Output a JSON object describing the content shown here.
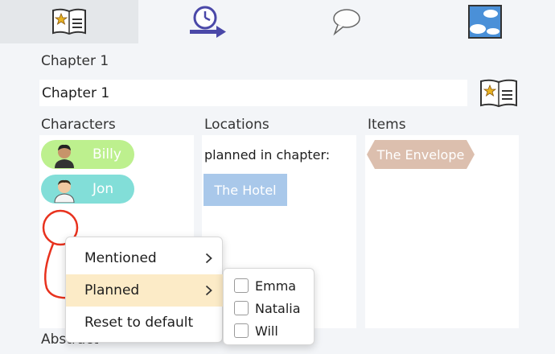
{
  "tabs": [
    {
      "name": "chapter-tab",
      "icon": "chapter-book-icon",
      "active": true
    },
    {
      "name": "timeline-tab",
      "icon": "clock-arrow-icon",
      "active": false
    },
    {
      "name": "dialogue-tab",
      "icon": "speech-bubble-icon",
      "active": false
    },
    {
      "name": "scene-tab",
      "icon": "sky-picture-icon",
      "active": false
    }
  ],
  "chapter": {
    "label": "Chapter 1",
    "title_value": "Chapter 1"
  },
  "columns": {
    "characters": "Characters",
    "locations": "Locations",
    "items": "Items"
  },
  "characters": [
    {
      "name": "Billy",
      "color": "#bdf08e"
    },
    {
      "name": "Jon",
      "color": "#82ded8"
    }
  ],
  "locations": {
    "section_label": "planned in chapter:",
    "entries": [
      {
        "name": "The Hotel",
        "color": "#a9c8ea"
      }
    ]
  },
  "items": [
    {
      "name": "The Envelope",
      "color": "#dcbfae"
    }
  ],
  "abstract_label": "Abstract",
  "context_menu": {
    "items": [
      {
        "label": "Mentioned",
        "has_submenu": true
      },
      {
        "label": "Planned",
        "has_submenu": true,
        "highlighted": true
      },
      {
        "label": "Reset to default",
        "has_submenu": false
      }
    ]
  },
  "submenu": {
    "options": [
      {
        "label": "Emma",
        "checked": false
      },
      {
        "label": "Natalia",
        "checked": false
      },
      {
        "label": "Will",
        "checked": false
      }
    ]
  },
  "colors": {
    "background": "#f3f5f8",
    "highlight": "#fcebc7",
    "annotation": "#e8321e"
  }
}
